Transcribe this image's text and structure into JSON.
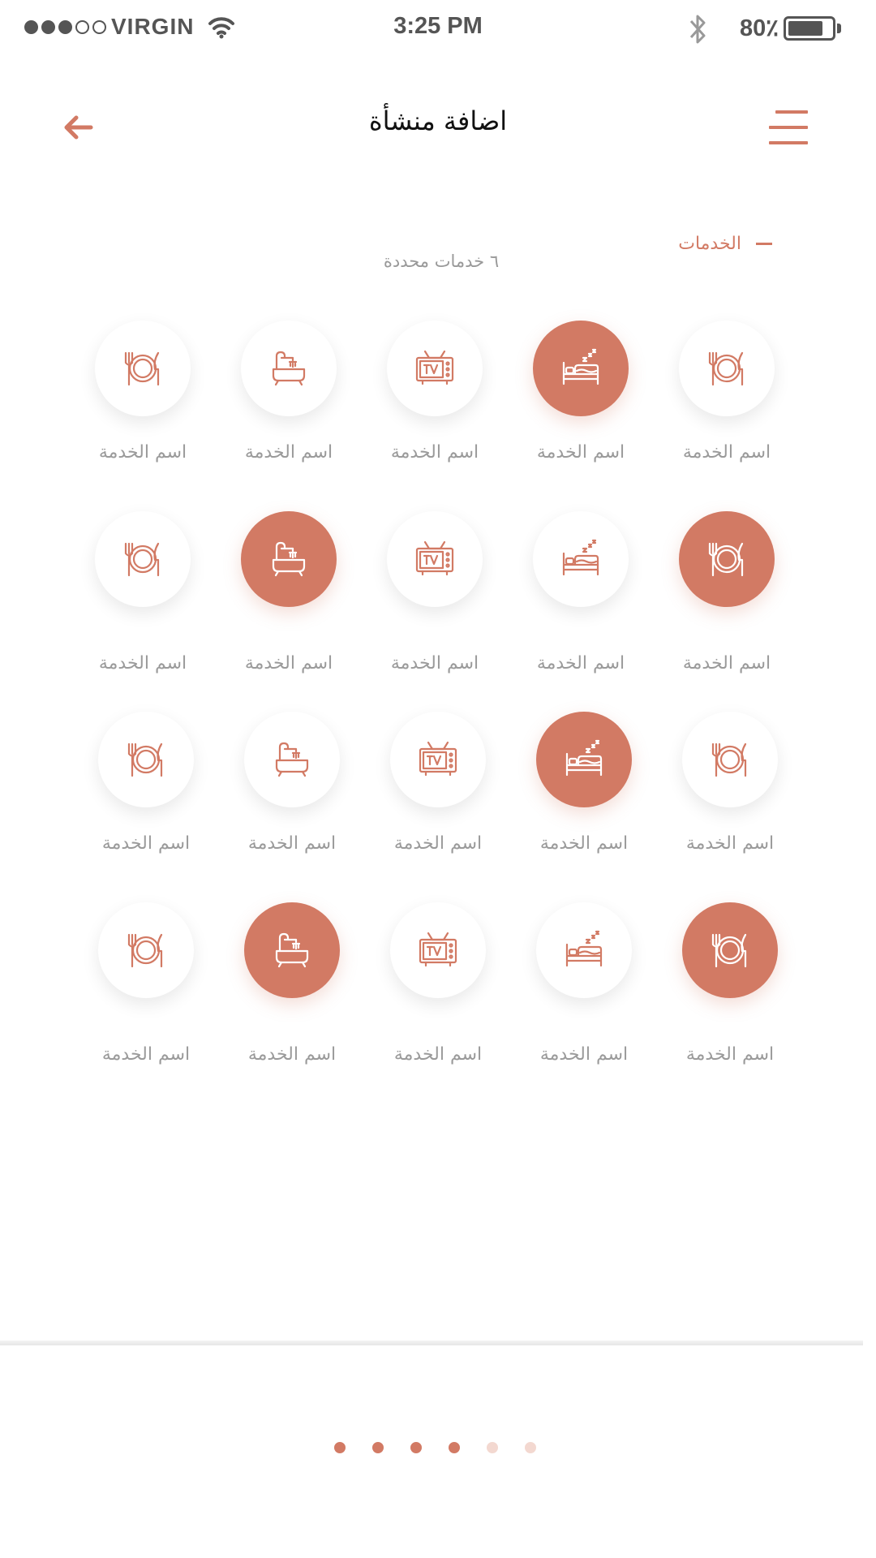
{
  "status_bar": {
    "carrier": "VIRGIN",
    "time": "3:25 PM",
    "battery_percent": "80٪",
    "battery_level": 0.8,
    "signal_bars_filled": 3,
    "signal_bars_total": 5
  },
  "header": {
    "title": "اضافة منشأة",
    "back_icon": "arrow-left-icon",
    "menu_icon": "menu-icon"
  },
  "section": {
    "label": "الخدمات",
    "toggle_icon": "minus-icon",
    "selected_count": "٦ خدمات محددة"
  },
  "colors": {
    "accent": "#d27a64",
    "label_gray": "#9a9a9a",
    "pager_inactive": "#f3d8d0"
  },
  "services": [
    {
      "label": "اسم الخدمة",
      "icon": "dining-icon",
      "selected": false
    },
    {
      "label": "اسم الخدمة",
      "icon": "bathtub-icon",
      "selected": false
    },
    {
      "label": "اسم الخدمة",
      "icon": "tv-icon",
      "selected": false
    },
    {
      "label": "اسم الخدمة",
      "icon": "bed-icon",
      "selected": true
    },
    {
      "label": "اسم الخدمة",
      "icon": "dining-icon",
      "selected": false
    },
    {
      "label": "اسم الخدمة",
      "icon": "dining-icon",
      "selected": false
    },
    {
      "label": "اسم الخدمة",
      "icon": "bathtub-icon",
      "selected": true
    },
    {
      "label": "اسم الخدمة",
      "icon": "tv-icon",
      "selected": false
    },
    {
      "label": "اسم الخدمة",
      "icon": "bed-icon",
      "selected": false
    },
    {
      "label": "اسم الخدمة",
      "icon": "dining-icon",
      "selected": true
    },
    {
      "label": "اسم الخدمة",
      "icon": "dining-icon",
      "selected": false
    },
    {
      "label": "اسم الخدمة",
      "icon": "bathtub-icon",
      "selected": false
    },
    {
      "label": "اسم الخدمة",
      "icon": "tv-icon",
      "selected": false
    },
    {
      "label": "اسم الخدمة",
      "icon": "bed-icon",
      "selected": true
    },
    {
      "label": "اسم الخدمة",
      "icon": "dining-icon",
      "selected": false
    },
    {
      "label": "اسم الخدمة",
      "icon": "dining-icon",
      "selected": false
    },
    {
      "label": "اسم الخدمة",
      "icon": "bathtub-icon",
      "selected": true
    },
    {
      "label": "اسم الخدمة",
      "icon": "tv-icon",
      "selected": false
    },
    {
      "label": "اسم الخدمة",
      "icon": "bed-icon",
      "selected": false
    },
    {
      "label": "اسم الخدمة",
      "icon": "dining-icon",
      "selected": true
    }
  ],
  "pager": {
    "total": 6,
    "active_count": 4
  }
}
